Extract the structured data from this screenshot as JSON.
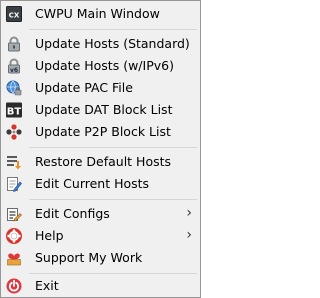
{
  "menu": {
    "items": {
      "main_window": {
        "label": "CWPU Main Window",
        "icon": "cwpu-app-icon"
      },
      "update_standard": {
        "label": "Update Hosts (Standard)",
        "icon": "lock-icon"
      },
      "update_ipv6": {
        "label": "Update Hosts (w/IPv6)",
        "icon": "lock-ipv6-icon"
      },
      "update_pac": {
        "label": "Update PAC File",
        "icon": "globe-lock-icon"
      },
      "update_dat": {
        "label": "Update DAT Block List",
        "icon": "bt-icon"
      },
      "update_p2p": {
        "label": "Update P2P Block List",
        "icon": "p2p-network-icon"
      },
      "restore_defaults": {
        "label": "Restore Default Hosts",
        "icon": "restore-icon"
      },
      "edit_current": {
        "label": "Edit Current Hosts",
        "icon": "edit-document-icon"
      },
      "edit_configs": {
        "label": "Edit Configs",
        "icon": "edit-configs-icon",
        "submenu_arrow": "›"
      },
      "help": {
        "label": "Help",
        "icon": "lifebuoy-icon",
        "submenu_arrow": "›"
      },
      "support": {
        "label": "Support My Work",
        "icon": "heart-box-icon"
      },
      "exit": {
        "label": "Exit",
        "icon": "exit-icon"
      }
    }
  },
  "colors": {
    "menu_background": "#f0f0f0",
    "menu_border": "#979797",
    "separator": "#d7d7d7",
    "text": "#000000"
  }
}
